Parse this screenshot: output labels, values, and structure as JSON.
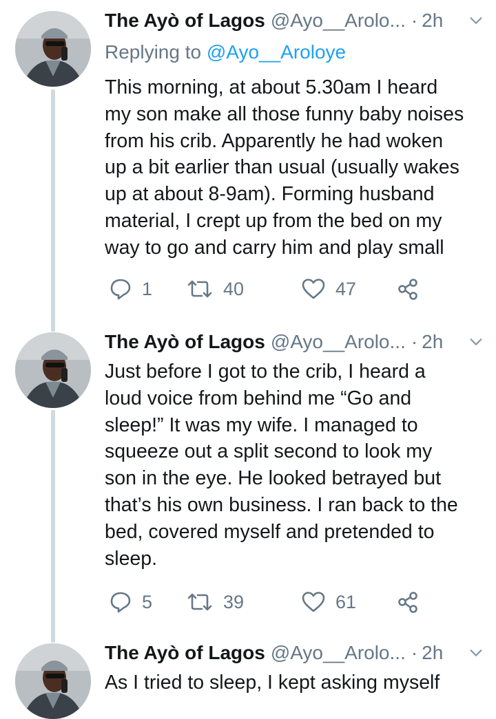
{
  "tweets": [
    {
      "display_name": "The Ayò of Lagos",
      "handle": "@Ayo__Arolo...",
      "separator": "·",
      "time": "2h",
      "replying_prefix": "Replying to ",
      "replying_to": "@Ayo__Aroloye",
      "lines": [
        "This morning, at about 5.30am I heard",
        "my son make all those funny baby noises",
        "from his crib. Apparently he had woken",
        "up a bit earlier than usual (usually wakes",
        "up at about 8-9am). Forming husband",
        "material, I crept up from the bed on my",
        "way to go and carry him and play small"
      ],
      "replies": "1",
      "retweets": "40",
      "likes": "47"
    },
    {
      "display_name": "The Ayò of Lagos",
      "handle": "@Ayo__Arolo...",
      "separator": "·",
      "time": "2h",
      "lines": [
        "Just before I got to the crib, I heard a",
        "loud voice from behind me “Go and",
        "sleep!” It was my wife. I managed to",
        "squeeze out a split second to look my",
        "son in the eye. He looked betrayed but",
        "that’s his own business. I ran back to the",
        "bed, covered myself and pretended to",
        "sleep."
      ],
      "replies": "5",
      "retweets": "39",
      "likes": "61"
    },
    {
      "display_name": "The Ayò of Lagos",
      "handle": "@Ayo__Arolo...",
      "separator": "·",
      "time": "2h",
      "lines": [
        "As I tried to sleep, I kept asking myself"
      ]
    }
  ],
  "icons": {
    "reply": "reply-icon",
    "retweet": "retweet-icon",
    "like": "heart-icon",
    "share": "share-icon",
    "caret": "chevron-down-icon"
  },
  "colors": {
    "text": "#14171a",
    "secondary": "#657786",
    "link": "#1da1f2",
    "thread_line": "#cfd9de"
  }
}
